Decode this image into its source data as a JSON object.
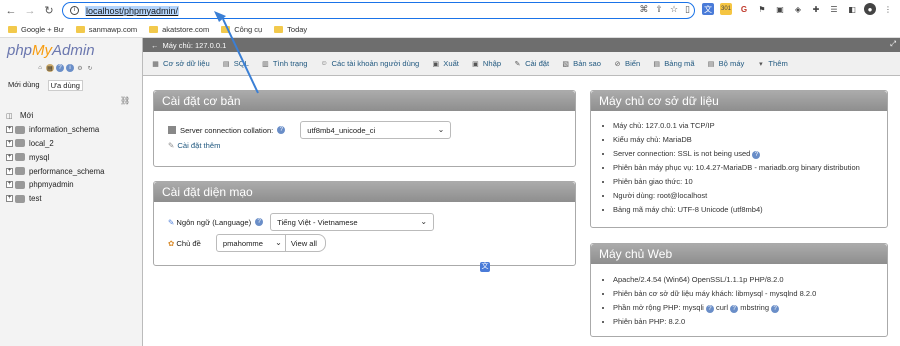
{
  "browser": {
    "url": "localhost/phpmyadmin/",
    "bookmarks": [
      {
        "label": "Google + Bư"
      },
      {
        "label": "sanmawp.com"
      },
      {
        "label": "akatstore.com"
      },
      {
        "label": "Công cụ"
      },
      {
        "label": "Today"
      }
    ]
  },
  "sidebar": {
    "logo_php": "php",
    "logo_my": "My",
    "logo_admin": "Admin",
    "tabs": [
      {
        "label": "Mới dùng"
      },
      {
        "label": "Ưa dùng"
      }
    ],
    "new_label": "Mới",
    "databases": [
      {
        "name": "information_schema"
      },
      {
        "name": "local_2"
      },
      {
        "name": "mysql"
      },
      {
        "name": "performance_schema"
      },
      {
        "name": "phpmyadmin"
      },
      {
        "name": "test"
      }
    ]
  },
  "server_bar": {
    "title": "Máy chủ: 127.0.0.1"
  },
  "topmenu": {
    "items": [
      {
        "label": "Cơ sở dữ liệu",
        "icon": "database-icon"
      },
      {
        "label": "SQL",
        "icon": "sql-icon"
      },
      {
        "label": "Tình trạng",
        "icon": "status-icon"
      },
      {
        "label": "Các tài khoản người dùng",
        "icon": "users-icon"
      },
      {
        "label": "Xuất",
        "icon": "export-icon"
      },
      {
        "label": "Nhập",
        "icon": "import-icon"
      },
      {
        "label": "Cài đặt",
        "icon": "settings-icon"
      },
      {
        "label": "Bản sao",
        "icon": "replication-icon"
      },
      {
        "label": "Biến",
        "icon": "variables-icon"
      },
      {
        "label": "Bảng mã",
        "icon": "charset-icon"
      },
      {
        "label": "Bộ máy",
        "icon": "engines-icon"
      },
      {
        "label": "Thêm",
        "icon": "more-icon"
      }
    ]
  },
  "general_settings": {
    "title": "Cài đặt cơ bản",
    "collation_label": "Server connection collation:",
    "collation_value": "utf8mb4_unicode_ci",
    "more_settings": "Cài đặt thêm"
  },
  "appearance": {
    "title": "Cài đặt diện mạo",
    "language_label": "Ngôn ngữ (Language)",
    "language_value": "Tiếng Việt - Vietnamese",
    "theme_label": "Chủ đề",
    "theme_value": "pmahomme",
    "view_all": "View all"
  },
  "db_server": {
    "title": "Máy chủ cơ sở dữ liệu",
    "items": [
      "Máy chủ: 127.0.0.1 via TCP/IP",
      "Kiểu máy chủ: MariaDB",
      "Server connection: SSL is not being used",
      "Phiên bản máy phục vụ: 10.4.27-MariaDB - mariadb.org binary distribution",
      "Phiên bản giao thức: 10",
      "Người dùng: root@localhost",
      "Bảng mã máy chủ: UTF-8 Unicode (utf8mb4)"
    ]
  },
  "web_server": {
    "title": "Máy chủ Web",
    "items": [
      "Apache/2.4.54 (Win64) OpenSSL/1.1.1p PHP/8.2.0",
      "Phiên bản cơ sở dữ liệu máy khách: libmysql - mysqlnd 8.2.0",
      "Phần mở rộng PHP: mysqli",
      "Phiên bản PHP: 8.2.0"
    ],
    "ext_curl": "curl",
    "ext_mbstring": "mbstring"
  },
  "colors": {
    "accent": "#1a73e8",
    "panel_head": "#9a9a9a",
    "link": "#235a81"
  }
}
